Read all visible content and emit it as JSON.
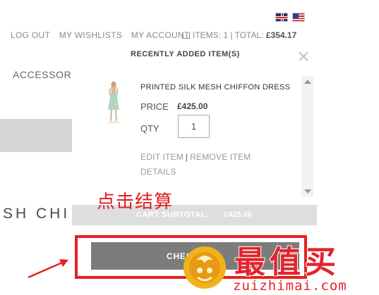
{
  "header": {
    "flags": [
      "uk-flag-icon",
      "us-flag-icon"
    ],
    "nav": [
      "LOG OUT",
      "MY WISHLISTS",
      "MY ACCOUNT"
    ],
    "cart_summary": {
      "items": "ITEMS: 1",
      "separator": "|",
      "total_label": "TOTAL:",
      "total_value": "£354.17"
    }
  },
  "background_page": {
    "category": "ACCESSORI",
    "product_title": "SH CHI"
  },
  "popup": {
    "heading": "RECENTLY ADDED ITEM(S)",
    "close_icon": "×",
    "item": {
      "name": "PRINTED SILK MESH CHIFFON DRESS",
      "price_label": "PRICE",
      "price_value": "£425.00",
      "qty_label": "QTY",
      "qty_value": "1",
      "edit_label": "EDIT ITEM",
      "remove_label": "REMOVE ITEM",
      "details_label": "DETAILS"
    },
    "subtotal_label": "CART SUBTOTAL:",
    "subtotal_value": "£425.00"
  },
  "checkout": {
    "label": "CHEC"
  },
  "annotation": {
    "text": "点击结算",
    "color": "#e5211c"
  },
  "watermark": {
    "chars": "最值买",
    "url": "zuizhimai.com"
  }
}
